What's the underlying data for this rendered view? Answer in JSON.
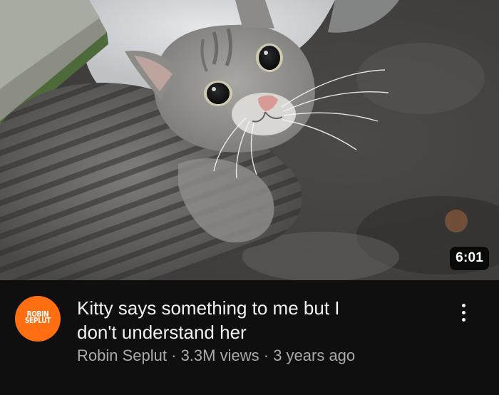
{
  "video": {
    "duration": "6:01",
    "title_line1": "Kitty says something to me but I",
    "title_line2": "don't understand her",
    "channel": "Robin Seplut",
    "separator": "·",
    "views": "3.3M views",
    "age": "3 years ago"
  },
  "avatar": {
    "line1": "ROBIN",
    "line2": "SEPLUT",
    "color": "#ff6f12"
  },
  "thumbnail": {
    "subject": "grey-tabby-cat"
  },
  "icons": {
    "more": "more-vertical-icon"
  }
}
